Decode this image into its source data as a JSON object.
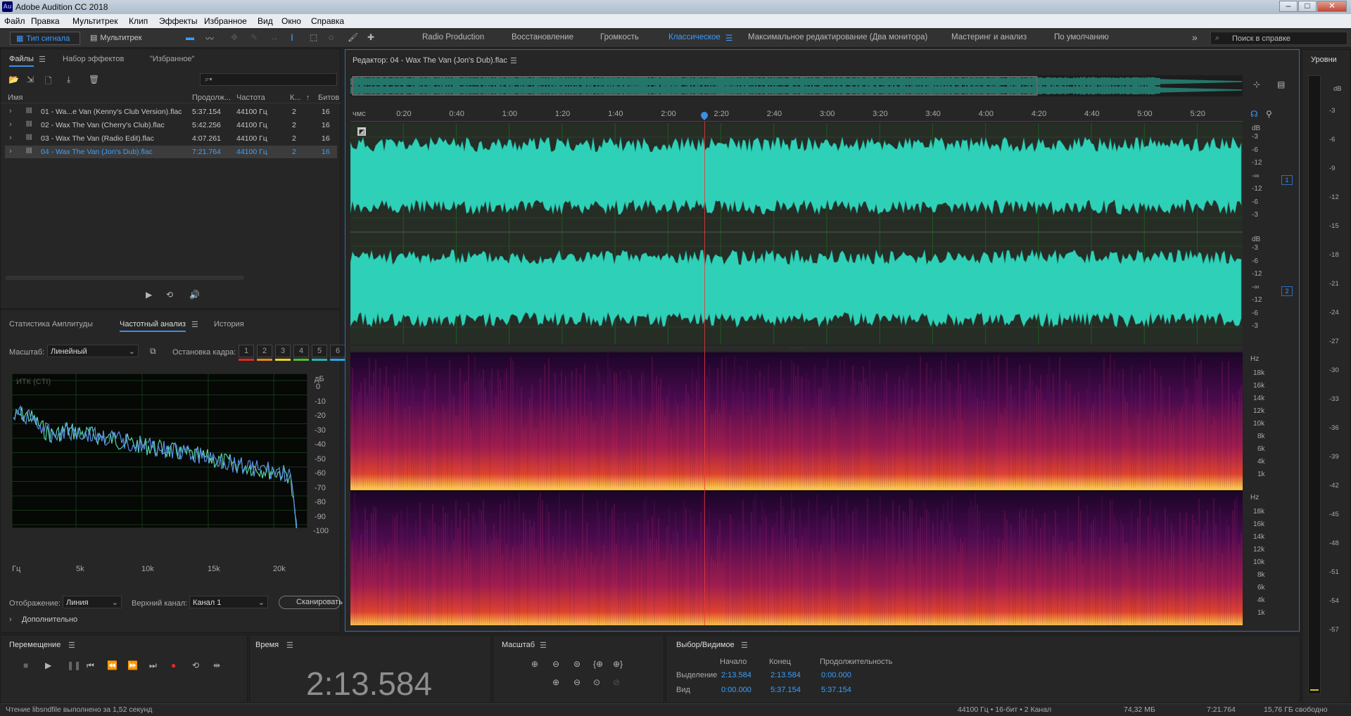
{
  "window": {
    "title": "Adobe Audition CC 2018",
    "app_badge": "Au",
    "controls": [
      "–",
      "□",
      "✕"
    ]
  },
  "menu": [
    "Файл",
    "Правка",
    "Мультитрек",
    "Клип",
    "Эффекты",
    "Избранное",
    "Вид",
    "Окно",
    "Справка"
  ],
  "toolbar": {
    "waveform_tab": "Тип сигнала",
    "multitrack_tab": "Мультитрек",
    "workspaces": [
      "Radio Production",
      "Восстановление",
      "Громкость",
      "Классическое",
      "Максимальное редактирование (Два монитора)",
      "Мастеринг и анализ",
      "По умолчанию"
    ],
    "active_workspace": "Классическое",
    "overflow": "»",
    "search_placeholder": "Поиск в справке"
  },
  "files_panel": {
    "tabs": [
      "Файлы",
      "Набор эффектов",
      "\"Избранное\""
    ],
    "search_icon": "⌕▾",
    "columns": [
      "Имя",
      "Продолж...",
      "Частота",
      "К...",
      "↑",
      "Битов"
    ],
    "rows": [
      {
        "name": "01 - Wa...e Van (Kenny's Club Version).flac",
        "dur": "5:37.154",
        "rate": "44100 Гц",
        "ch": "2",
        "bits": "16"
      },
      {
        "name": "02 - Wax The Van (Cherry's Club).flac",
        "dur": "5:42.256",
        "rate": "44100 Гц",
        "ch": "2",
        "bits": "16"
      },
      {
        "name": "03 - Wax The Van (Radio Edit).flac",
        "dur": "4:07.261",
        "rate": "44100 Гц",
        "ch": "2",
        "bits": "16"
      },
      {
        "name": "04 - Wax The Van (Jon's Dub).flac",
        "dur": "7:21.764",
        "rate": "44100 Гц",
        "ch": "2",
        "bits": "16"
      }
    ]
  },
  "analysis_panel": {
    "tabs": [
      "Статистика Амплитуды",
      "Частотный анализ",
      "История"
    ],
    "scale_label": "Масштаб:",
    "scale_value": "Линейный",
    "hold_label": "Остановка кадра:",
    "hold_buttons": [
      "1",
      "2",
      "3",
      "4",
      "5",
      "6"
    ],
    "hold_colors": [
      "#e02a1f",
      "#e48a1d",
      "#e8d51f",
      "#4fbf2c",
      "#26b7b2",
      "#2aa6e8"
    ],
    "plot_label": "ИТК (CTI)",
    "db_unit": "дБ",
    "db_ticks": [
      "0",
      "-10",
      "-20",
      "-30",
      "-40",
      "-50",
      "-60",
      "-70",
      "-80",
      "-90",
      "-100"
    ],
    "hz_unit": "Гц",
    "freq_ticks": [
      "5k",
      "10k",
      "15k",
      "20k"
    ],
    "display_label": "Отображение:",
    "display_value": "Линия",
    "channel_label": "Верхний канал:",
    "channel_value": "Канал 1",
    "scan_button": "Сканировать",
    "advanced": "Дополнительно"
  },
  "editor": {
    "title": "Редактор: 04 - Wax The Van (Jon's Dub).flac",
    "time_unit": "чмс",
    "ruler": [
      "0:20",
      "0:40",
      "1:00",
      "1:20",
      "1:40",
      "2:00",
      "2:20",
      "2:40",
      "3:00",
      "3:20",
      "3:40",
      "4:00",
      "4:20",
      "4:40",
      "5:00",
      "5:20"
    ],
    "playhead_fraction": 0.397,
    "db_label": "dB",
    "db_scale": [
      "-3",
      "-6",
      "-12",
      "-∞",
      "-12",
      "-6",
      "-3"
    ],
    "ch1": "1",
    "ch2": "2",
    "hz_label": "Hz",
    "hz_scale": [
      "18k",
      "16k",
      "14k",
      "12k",
      "10k",
      "8k",
      "6k",
      "4k",
      "1k"
    ]
  },
  "levels": {
    "title": "Уровни",
    "scale": [
      "dB",
      "-3",
      "-6",
      "-9",
      "-12",
      "-15",
      "-18",
      "-21",
      "-24",
      "-27",
      "-30",
      "-33",
      "-36",
      "-39",
      "-42",
      "-45",
      "-48",
      "-51",
      "-54",
      "-57"
    ]
  },
  "transport": {
    "title": "Перемещение"
  },
  "time": {
    "title": "Время",
    "value": "2:13.584"
  },
  "zoom": {
    "title": "Масштаб"
  },
  "selection": {
    "title": "Выбор/Видимое",
    "col_start": "Начало",
    "col_end": "Конец",
    "col_dur": "Продолжительность",
    "sel_label": "Выделение",
    "sel_start": "2:13.584",
    "sel_end": "2:13.584",
    "sel_dur": "0:00.000",
    "view_label": "Вид",
    "view_start": "0:00.000",
    "view_end": "5:37.154",
    "view_dur": "5:37.154"
  },
  "status": {
    "left": "Чтение libsndfile выполнено за 1,52 секунд",
    "format": "44100 Гц • 16-бит • 2 Канал",
    "size": "74,32 МБ",
    "duration": "7:21.764",
    "free": "15,76 ГБ свободно"
  }
}
